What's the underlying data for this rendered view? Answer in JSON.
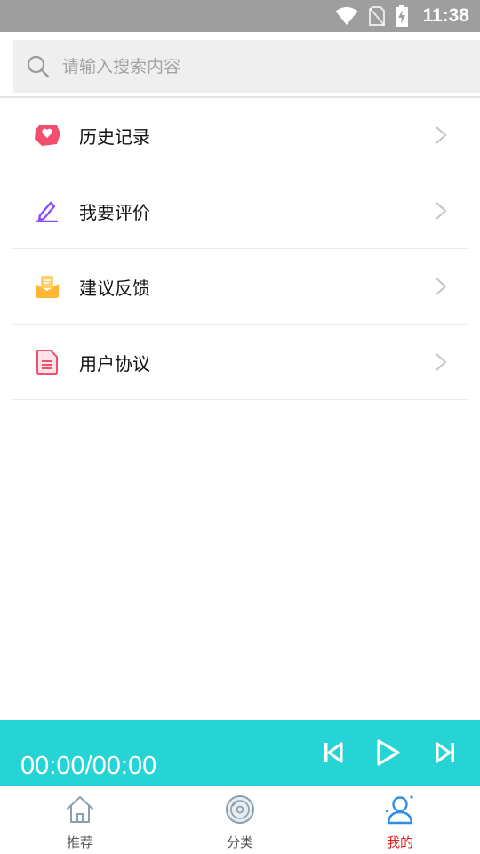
{
  "status_bar": {
    "time": "11:38",
    "icons": [
      "wifi-icon",
      "no-sim-icon",
      "battery-charging-icon"
    ]
  },
  "search": {
    "placeholder": "请输入搜索内容",
    "value": "",
    "icon": "search-icon"
  },
  "menu": {
    "items": [
      {
        "label": "历史记录",
        "icon": "history-icon",
        "color": "#f0506e"
      },
      {
        "label": "我要评价",
        "icon": "edit-pencil-icon",
        "color": "#8a4dff"
      },
      {
        "label": "建议反馈",
        "icon": "feedback-envelope-icon",
        "color": "#ffb734"
      },
      {
        "label": "用户协议",
        "icon": "document-icon",
        "color": "#f0506e"
      }
    ]
  },
  "player": {
    "time": "00:00/00:00",
    "background": "#26d4d6",
    "controls": [
      "previous-icon",
      "play-icon",
      "next-icon"
    ]
  },
  "bottom_nav": {
    "items": [
      {
        "label": "推荐",
        "icon": "home-icon",
        "active": false
      },
      {
        "label": "分类",
        "icon": "disc-icon",
        "active": false
      },
      {
        "label": "我的",
        "icon": "user-icon",
        "active": true
      }
    ],
    "active_color": "#e02020"
  }
}
